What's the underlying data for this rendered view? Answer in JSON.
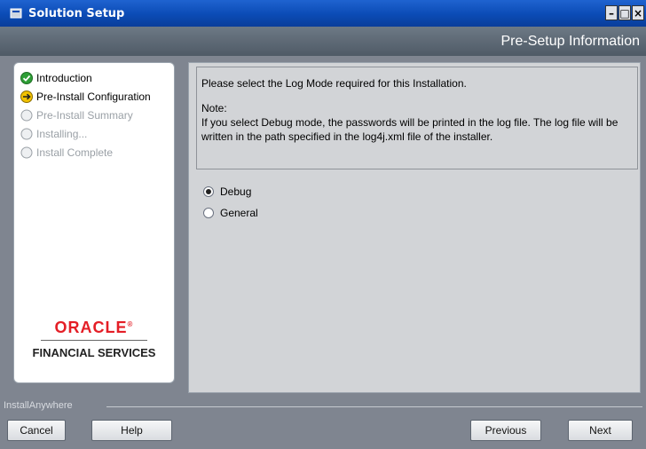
{
  "window": {
    "title": "Solution Setup",
    "buttons": {
      "minimize": "–",
      "maximize": "□",
      "close": "×"
    }
  },
  "header": {
    "title": "Pre-Setup Information"
  },
  "sidebar": {
    "steps": [
      {
        "label": "Introduction",
        "state": "completed"
      },
      {
        "label": "Pre-Install Configuration",
        "state": "current"
      },
      {
        "label": "Pre-Install Summary",
        "state": "pending"
      },
      {
        "label": "Installing...",
        "state": "pending"
      },
      {
        "label": "Install Complete",
        "state": "pending"
      }
    ],
    "logo": {
      "brand": "ORACLE",
      "registered": "®",
      "subtitle": "FINANCIAL SERVICES"
    }
  },
  "content": {
    "intro": "Please select the Log Mode required for this Installation.",
    "note_label": "Note:",
    "note_text": "If you select Debug mode, the passwords will be printed in the log file. The log file will be written in the path specified in the log4j.xml file of the installer.",
    "options": [
      {
        "label": "Debug",
        "checked": true
      },
      {
        "label": "General",
        "checked": false
      }
    ]
  },
  "footer": {
    "label": "InstallAnywhere",
    "buttons": {
      "cancel": "Cancel",
      "help": "Help",
      "previous": "Previous",
      "next": "Next"
    }
  },
  "colors": {
    "titlebar": "#0b4bb5",
    "oracle_red": "#e41e26",
    "current_step": "#f2c200",
    "completed_step": "#2e9e36"
  }
}
